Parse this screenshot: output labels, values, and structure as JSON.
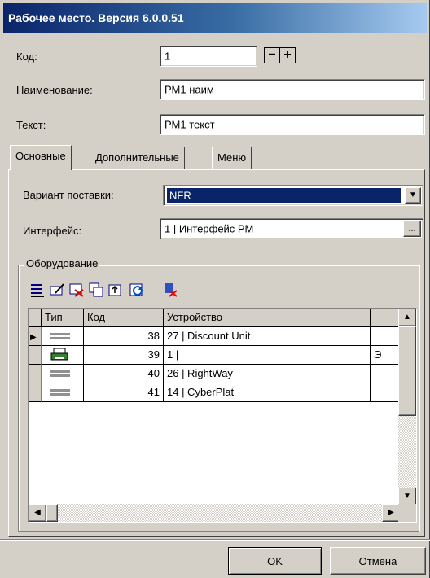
{
  "window": {
    "title": "Рабочее место. Версия 6.0.0.51"
  },
  "form": {
    "code_label": "Код:",
    "code_value": "1",
    "stepper_minus": "−",
    "stepper_plus": "+",
    "name_label": "Наименование:",
    "name_value": "РМ1 наим",
    "text_label": "Текст:",
    "text_value": "РМ1 текст"
  },
  "tabs": [
    {
      "label": "Основные",
      "active": true
    },
    {
      "label": "Дополнительные",
      "active": false
    },
    {
      "label": "Меню",
      "active": false
    }
  ],
  "main": {
    "delivery_label": "Вариант поставки:",
    "delivery_value": "NFR",
    "interface_label": "Интерфейс:",
    "interface_value": "1 | Интерфейс РМ",
    "browse_label": "..."
  },
  "equipment": {
    "title": "Оборудование",
    "toolbar_icons": [
      "list-add-icon",
      "edit-icon",
      "delete-icon",
      "copy-icon",
      "export-icon",
      "refresh-icon",
      "delete-all-icon"
    ],
    "columns": [
      "Тип",
      "Код",
      "Устройство"
    ],
    "rows": [
      {
        "type_icon": "device-icon",
        "code": "38",
        "device": "27 | Discount Unit",
        "extra": ""
      },
      {
        "type_icon": "printer-icon",
        "code": "39",
        "device": "1 |",
        "extra": "Э"
      },
      {
        "type_icon": "device-icon",
        "code": "40",
        "device": "26 | RightWay",
        "extra": ""
      },
      {
        "type_icon": "device-icon",
        "code": "41",
        "device": "14 | CyberPlat",
        "extra": ""
      }
    ]
  },
  "buttons": {
    "ok": "OK",
    "cancel": "Отмена"
  },
  "colors": {
    "title_start": "#0a246a",
    "title_end": "#a6caf0",
    "face": "#d4d0c8",
    "selection": "#0a246a"
  }
}
